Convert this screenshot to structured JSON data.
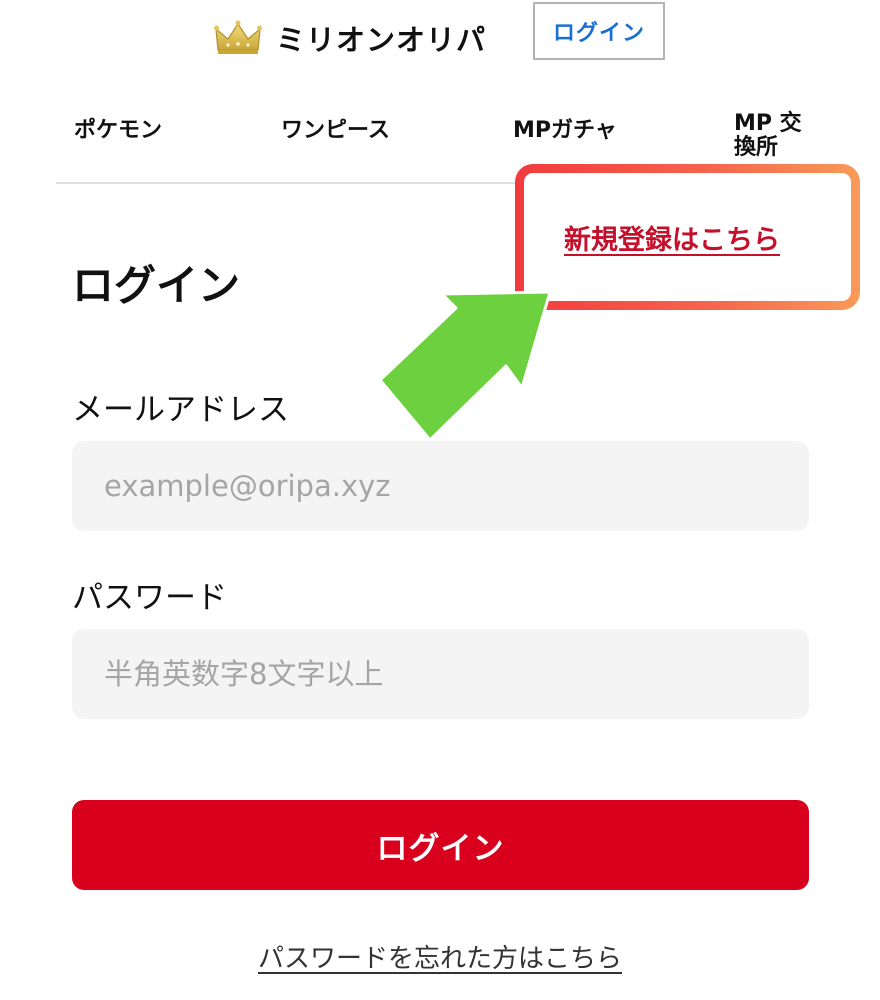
{
  "header": {
    "brand_name": "ミリオンオリパ",
    "login_button": "ログイン"
  },
  "nav": {
    "items": [
      {
        "label": "ポケモン"
      },
      {
        "label": "ワンピース"
      },
      {
        "label": "MPガチャ"
      },
      {
        "label": "MP 交換所"
      }
    ]
  },
  "register": {
    "link_label": "新規登録はこちら"
  },
  "form": {
    "title": "ログイン",
    "email": {
      "label": "メールアドレス",
      "placeholder": "example@oripa.xyz",
      "value": ""
    },
    "password": {
      "label": "パスワード",
      "placeholder": "半角英数字8文字以上",
      "value": ""
    },
    "submit_label": "ログイン",
    "forgot_label": "パスワードを忘れた方はこちら"
  },
  "icons": {
    "brand_logo": "crown-icon",
    "annotation": "pointer-arrow-icon"
  },
  "colors": {
    "primary_button": "#d8001c",
    "register_link": "#c4102a",
    "header_login_text": "#1a6fd1",
    "highlight_start": "#f23a3d",
    "highlight_end": "#f99a58",
    "arrow": "#6dd13f",
    "input_bg": "#f4f4f4"
  }
}
